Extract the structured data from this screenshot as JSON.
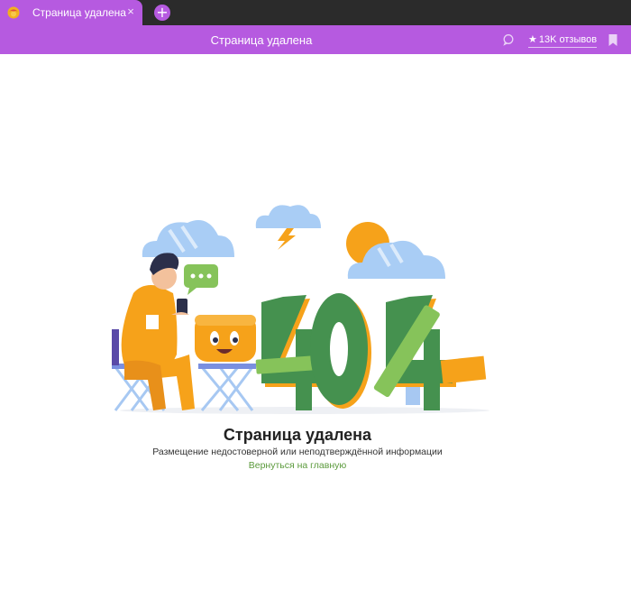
{
  "tab": {
    "title": "Страница удалена",
    "close_icon": "×",
    "favicon": "logo-icon"
  },
  "new_tab_icon": "+",
  "titlebar": {
    "heading": "Страница удалена",
    "chat_icon": "chat-bubble-icon",
    "reviews_star": "★",
    "reviews_label": "13K отзывов",
    "bookmark_icon": "bookmark-icon"
  },
  "main": {
    "illustration_text": "404",
    "title": "Страница удалена",
    "description": "Размещение недостоверной или неподтверждённой информации",
    "home_link": "Вернуться на главную"
  },
  "colors": {
    "accent": "#b65ae0",
    "tab_strip": "#2b2b2b",
    "link": "#5b9a3c",
    "orange": "#f6a21a",
    "green": "#45914f"
  }
}
